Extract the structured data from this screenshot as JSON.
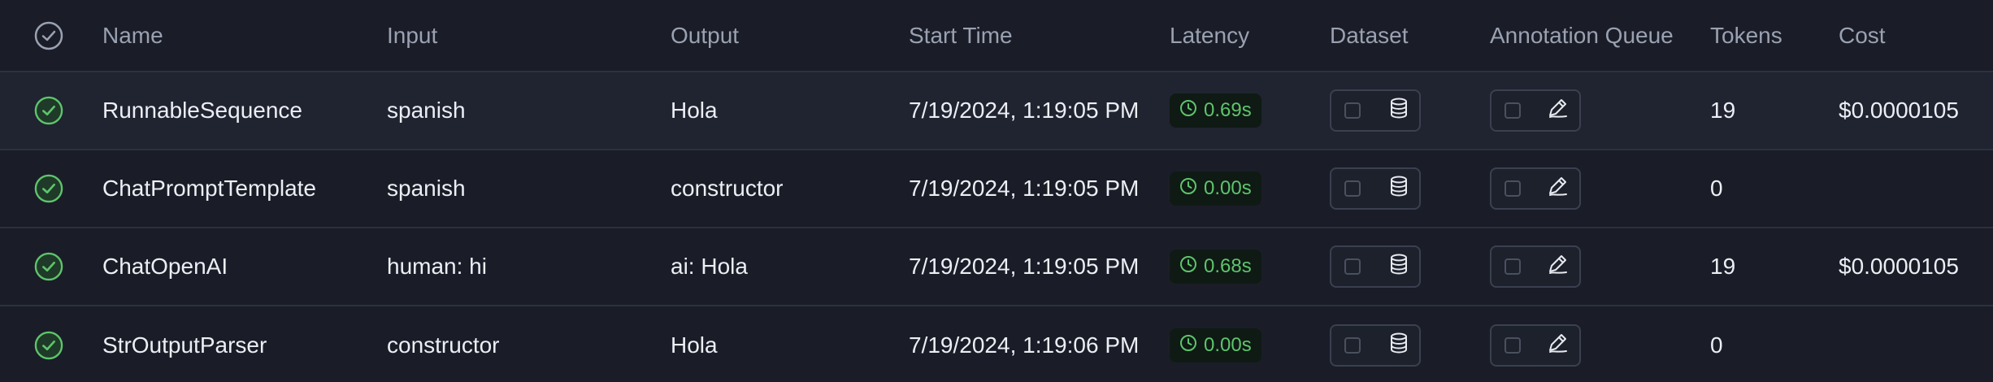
{
  "header": {
    "select_all_icon": "circle-check-icon",
    "columns": {
      "name": "Name",
      "input": "Input",
      "output": "Output",
      "start_time": "Start Time",
      "latency": "Latency",
      "dataset": "Dataset",
      "annotation_queue": "Annotation Queue",
      "tokens": "Tokens",
      "cost": "Cost"
    }
  },
  "rows": [
    {
      "status_icon": "success-check-icon",
      "name": "RunnableSequence",
      "input": "spanish",
      "output": "Hola",
      "start_time": "7/19/2024, 1:19:05 PM",
      "latency": "0.69s",
      "tokens": "19",
      "cost": "$0.0000105"
    },
    {
      "status_icon": "success-check-icon",
      "name": "ChatPromptTemplate",
      "input": "spanish",
      "output": "constructor",
      "start_time": "7/19/2024, 1:19:05 PM",
      "latency": "0.00s",
      "tokens": "0",
      "cost": ""
    },
    {
      "status_icon": "success-check-icon",
      "name": "ChatOpenAI",
      "input": "human: hi",
      "output": "ai: Hola",
      "start_time": "7/19/2024, 1:19:05 PM",
      "latency": "0.68s",
      "tokens": "19",
      "cost": "$0.0000105"
    },
    {
      "status_icon": "success-check-icon",
      "name": "StrOutputParser",
      "input": "constructor",
      "output": "Hola",
      "start_time": "7/19/2024, 1:19:06 PM",
      "latency": "0.00s",
      "tokens": "0",
      "cost": ""
    }
  ],
  "colors": {
    "background": "#1a1d27",
    "row_highlight": "#1f2430",
    "success_green": "#5ec46c",
    "border": "#2c3140"
  }
}
